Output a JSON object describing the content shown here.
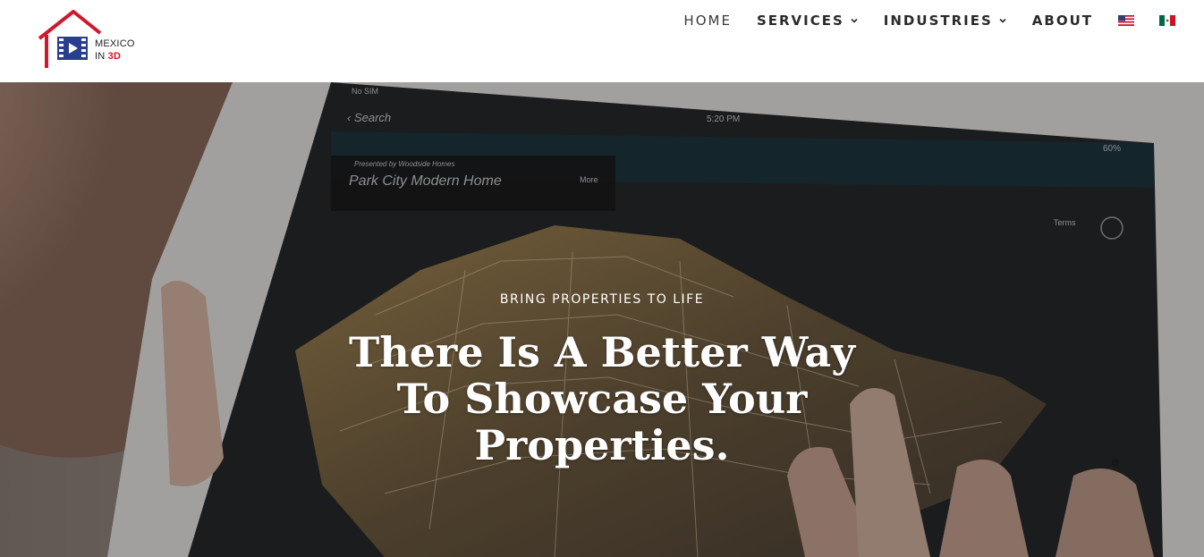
{
  "brand": {
    "line1": "MEXICO",
    "line2_prefix": "IN ",
    "line2_accent": "3D",
    "accent_color": "#d0182b",
    "icon": "house-film-logo-icon"
  },
  "nav": {
    "home": "HOME",
    "services": "SERVICES",
    "industries": "INDUSTRIES",
    "about": "ABOUT",
    "lang_en_icon": "us-flag-icon",
    "lang_es_icon": "mexico-flag-icon"
  },
  "hero": {
    "eyebrow": "BRING PROPERTIES TO LIFE",
    "headline_line1": "There Is A Better Way",
    "headline_line2": "To Showcase Your",
    "headline_line3": "Properties."
  },
  "ipad_screen": {
    "status_left": "No SIM",
    "back_label": "Search",
    "time": "5:20 PM",
    "battery": "60%",
    "presented_by": "Presented by Woodside Homes",
    "listing_title": "Park City Modern Home",
    "more_label": "More",
    "terms_label": "Terms"
  }
}
